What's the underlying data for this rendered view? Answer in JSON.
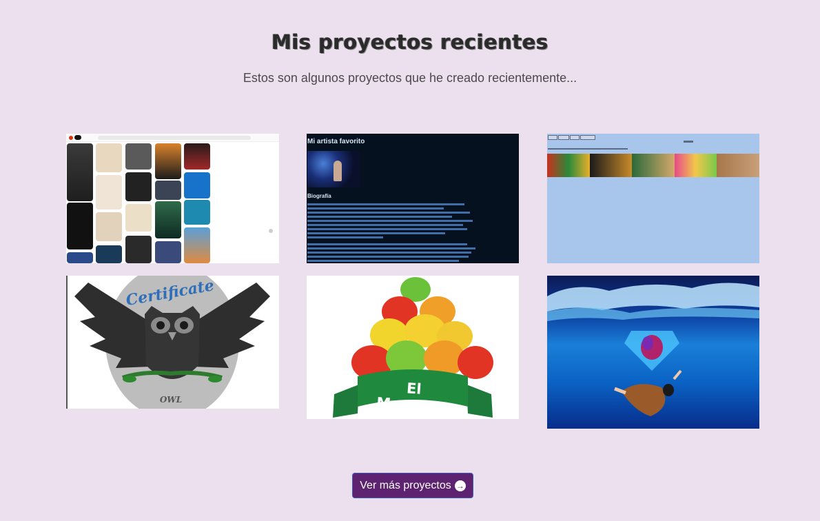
{
  "header": {
    "title": "Mis proyectos recientes",
    "subtitle": "Estos son algunos proyectos que he creado recientemente..."
  },
  "projects": [
    {
      "name": "pinterest-board"
    },
    {
      "name": "artista-favorito",
      "heading": "Mi artista favorito",
      "section": "Biografía"
    },
    {
      "name": "tienda-dulces"
    },
    {
      "name": "owl-certificate"
    },
    {
      "name": "el-manzano",
      "brand": "El Manzano"
    },
    {
      "name": "underwater-illustration"
    }
  ],
  "cta": {
    "label": "Ver más proyectos",
    "icon": "arrow-right-circle-icon"
  },
  "colors": {
    "background": "#ece0ee",
    "button": "#5e2370",
    "button_border": "#3d5fb8"
  }
}
